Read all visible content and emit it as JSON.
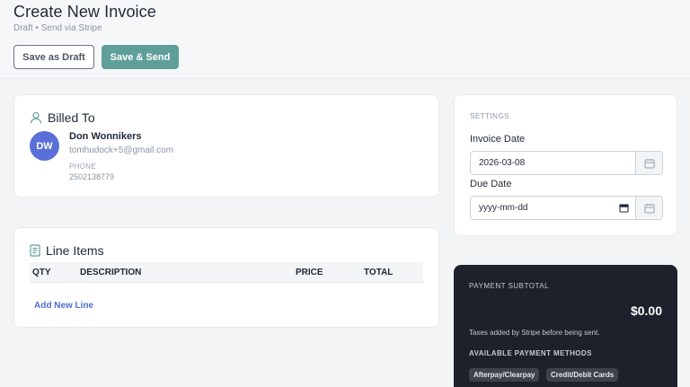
{
  "header": {
    "title": "Create New Invoice",
    "subtitle": "Draft • Send via Stripe",
    "save_draft_label": "Save as Draft",
    "save_send_label": "Save & Send"
  },
  "billed_to": {
    "title": "Billed To",
    "avatar_initials": "DW",
    "name": "Don Wonnikers",
    "email": "tomhudock+5@gmail.com",
    "phone_label": "PHONE",
    "phone": "2502138779",
    "icon": "user-icon"
  },
  "line_items": {
    "title": "Line Items",
    "icon": "document-icon",
    "columns": [
      "QTY",
      "DESCRIPTION",
      "PRICE",
      "TOTAL"
    ],
    "rows": [],
    "add_line_label": "Add New Line"
  },
  "settings": {
    "title": "SETTINGS",
    "invoice_date_label": "Invoice Date",
    "invoice_date_value": "2026-03-08",
    "due_date_label": "Due Date",
    "due_date_placeholder": "yyyy-mm-dd"
  },
  "payment": {
    "subtotal_label": "PAYMENT SUBTOTAL",
    "amount": "$0.00",
    "note": "Taxes added by Stripe before being sent.",
    "methods_label": "AVAILABLE PAYMENT METHODS",
    "methods": [
      "Afterpay/Clearpay",
      "Credit/Debit Cards"
    ]
  },
  "colors": {
    "accent": "#5f9f9a",
    "avatar": "#5b6fd8",
    "link": "#4f6fcf",
    "payment_bg": "#1c212b"
  }
}
